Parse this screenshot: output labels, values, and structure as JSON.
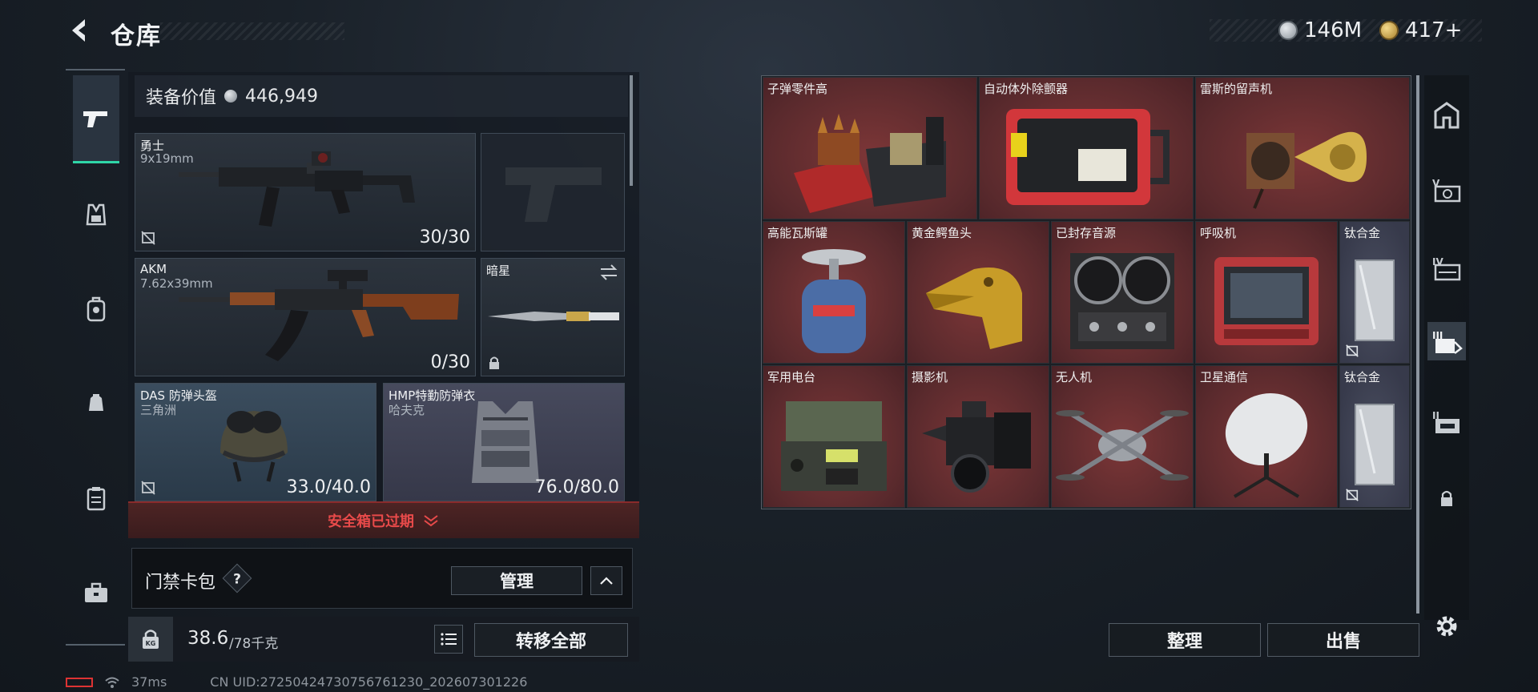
{
  "header": {
    "title": "仓库",
    "currency_silver": "146M",
    "currency_gold": "417+"
  },
  "loadout": {
    "equip_value_label": "装备价值",
    "equip_value": "446,949",
    "primary": {
      "name": "勇士",
      "caliber": "9x19mm",
      "ammo": "30/30"
    },
    "secondary": {
      "name": "AKM",
      "caliber": "7.62x39mm",
      "ammo": "0/30"
    },
    "melee": {
      "name": "暗星"
    },
    "helmet": {
      "name": "DAS 防弹头盔",
      "maker": "三角洲",
      "durability": "33.0/40.0"
    },
    "armor": {
      "name": "HMP特勤防弹衣",
      "maker": "哈夫克",
      "durability": "76.0/80.0"
    },
    "safebox_expired": "安全箱已过期",
    "keycard_label": "门禁卡包",
    "help_glyph": "?",
    "manage_label": "管理",
    "weight_current": "38.6",
    "weight_max": "/78千克",
    "transfer_all_label": "转移全部"
  },
  "storage": {
    "items": [
      {
        "label": "子弹零件高",
        "icon": "ammo-parts-icon",
        "color": "red"
      },
      {
        "label": "自动体外除颤器",
        "icon": "defibrillator-icon",
        "color": "red"
      },
      {
        "label": "雷斯的留声机",
        "icon": "gramophone-icon",
        "color": "red"
      },
      {
        "label": "高能瓦斯罐",
        "icon": "gas-canister-icon",
        "color": "red"
      },
      {
        "label": "黄金鳄鱼头",
        "icon": "gold-crocodile-icon",
        "color": "red"
      },
      {
        "label": "已封存音源",
        "icon": "reel-recorder-icon",
        "color": "red"
      },
      {
        "label": "呼吸机",
        "icon": "ventilator-icon",
        "color": "red"
      },
      {
        "label": "钛合金",
        "icon": "titanium-plate-icon",
        "color": "gray"
      },
      {
        "label": "军用电台",
        "icon": "military-radio-icon",
        "color": "red"
      },
      {
        "label": "摄影机",
        "icon": "camera-icon",
        "color": "red"
      },
      {
        "label": "无人机",
        "icon": "drone-icon",
        "color": "red"
      },
      {
        "label": "卫星通信",
        "icon": "satellite-dish-icon",
        "color": "red"
      },
      {
        "label": "钛合金",
        "icon": "titanium-plate-icon",
        "color": "gray"
      }
    ],
    "sort_label": "整理",
    "sell_label": "出售"
  },
  "right_rail": {
    "tabs": [
      "home-icon",
      "v-storage-icon",
      "iv-storage-icon",
      "iii-storage-icon",
      "ii-storage-icon",
      "lock-icon"
    ]
  },
  "status": {
    "ping": "37ms",
    "uid": "CN UID:27250424730756761230_202607301226"
  },
  "colors": {
    "accent_green": "#2fd6a7",
    "warning_red": "#e84a4a",
    "item_red": "#6a2f31",
    "item_gray": "#41445a"
  }
}
